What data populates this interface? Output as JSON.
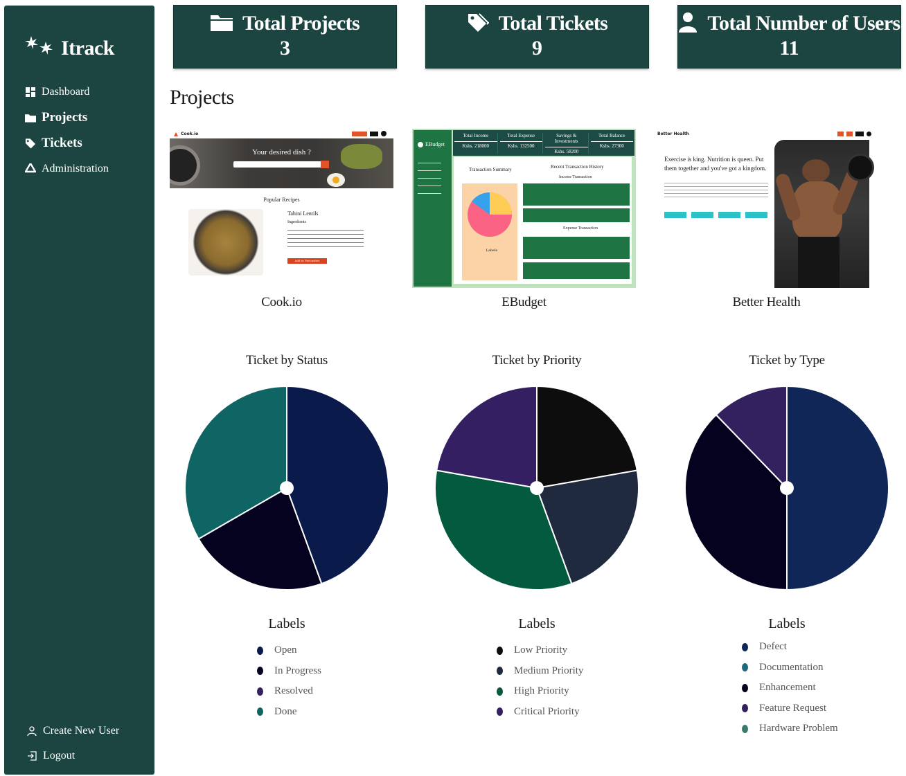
{
  "app": {
    "name": "Itrack"
  },
  "sidebar": {
    "items": [
      {
        "label": "Dashboard",
        "icon": "dashboard-icon",
        "bold": false
      },
      {
        "label": "Projects",
        "icon": "folder-icon",
        "bold": true
      },
      {
        "label": "Tickets",
        "icon": "tag-icon",
        "bold": true
      },
      {
        "label": "Administration",
        "icon": "recycle-icon",
        "bold": false
      }
    ],
    "bottom": [
      {
        "label": "Create New User",
        "icon": "user-outline-icon"
      },
      {
        "label": "Logout",
        "icon": "logout-icon"
      }
    ]
  },
  "stats": [
    {
      "title": "Total Projects",
      "value": "3",
      "icon": "folder-icon"
    },
    {
      "title": "Total Tickets",
      "value": "9",
      "icon": "tag-icon"
    },
    {
      "title": "Total Number of Users",
      "value": "11",
      "icon": "user-icon"
    }
  ],
  "projects_section": {
    "title": "Projects"
  },
  "projects": [
    {
      "name": "Cook.io",
      "thumb": {
        "brand": "Cook.io",
        "hero": "Your desired dish ?",
        "section": "Popular Recipes",
        "recipe": "Tahini Lentils",
        "sub": "Ingredients",
        "button": "Add to Favourites"
      }
    },
    {
      "name": "EBudget",
      "thumb": {
        "brand": "EBudget",
        "cards": [
          {
            "label": "Total Income",
            "value": "Kshs. 218000"
          },
          {
            "label": "Total Expense",
            "value": "Kshs. 132500"
          },
          {
            "label": "Savings & Investments",
            "value": "Kshs. 58200"
          },
          {
            "label": "Total Balance",
            "value": "Kshs. 27300"
          }
        ],
        "summary": "Transaction Summary",
        "history": "Recent Transaction History",
        "income": "Income Transaction",
        "expense": "Expense Transaction",
        "labels": "Labels"
      }
    },
    {
      "name": "Better Health",
      "thumb": {
        "brand": "Better Health",
        "headline": "Exercise is king. Nutrition is queen. Put them together and you've got a kingdom."
      }
    }
  ],
  "charts": [
    {
      "title": "Ticket by Status",
      "labels_title": "Labels",
      "legend": [
        {
          "label": "Open",
          "color": "#0a1a4a"
        },
        {
          "label": "In Progress",
          "color": "#05021f"
        },
        {
          "label": "Resolved",
          "color": "#33205e"
        },
        {
          "label": "Done",
          "color": "#0e6563"
        }
      ]
    },
    {
      "title": "Ticket by Priority",
      "labels_title": "Labels",
      "legend": [
        {
          "label": "Low Priority",
          "color": "#0d0d0d"
        },
        {
          "label": "Medium Priority",
          "color": "#1f2a3e"
        },
        {
          "label": "High Priority",
          "color": "#045a3f"
        },
        {
          "label": "Critical Priority",
          "color": "#341f62"
        }
      ]
    },
    {
      "title": "Ticket by Type",
      "labels_title": "Labels",
      "legend": [
        {
          "label": "Defect",
          "color": "#0f2657"
        },
        {
          "label": "Documentation",
          "color": "#1d6b7a"
        },
        {
          "label": "Enhancement",
          "color": "#05021f"
        },
        {
          "label": "Feature Request",
          "color": "#33205e"
        },
        {
          "label": "Hardware Problem",
          "color": "#3a7d6c"
        }
      ]
    }
  ],
  "chart_data": [
    {
      "type": "pie",
      "title": "Ticket by Status",
      "slices": [
        {
          "label": "Open",
          "value": 4,
          "color": "#0a1a4a"
        },
        {
          "label": "In Progress",
          "value": 2,
          "color": "#05021f"
        },
        {
          "label": "Done",
          "value": 3,
          "color": "#0e6563"
        }
      ]
    },
    {
      "type": "pie",
      "title": "Ticket by Priority",
      "slices": [
        {
          "label": "Low Priority",
          "value": 2,
          "color": "#0d0d0d"
        },
        {
          "label": "Medium Priority",
          "value": 2,
          "color": "#1f2a3e"
        },
        {
          "label": "High Priority",
          "value": 3,
          "color": "#045a3f"
        },
        {
          "label": "Critical Priority",
          "value": 2,
          "color": "#341f62"
        }
      ]
    },
    {
      "type": "pie",
      "title": "Ticket by Type",
      "slices": [
        {
          "label": "Defect",
          "value": 4.5,
          "color": "#0f2657"
        },
        {
          "label": "Enhancement",
          "value": 3.4,
          "color": "#05021f"
        },
        {
          "label": "Feature Request",
          "value": 1.1,
          "color": "#33205e"
        }
      ]
    }
  ]
}
